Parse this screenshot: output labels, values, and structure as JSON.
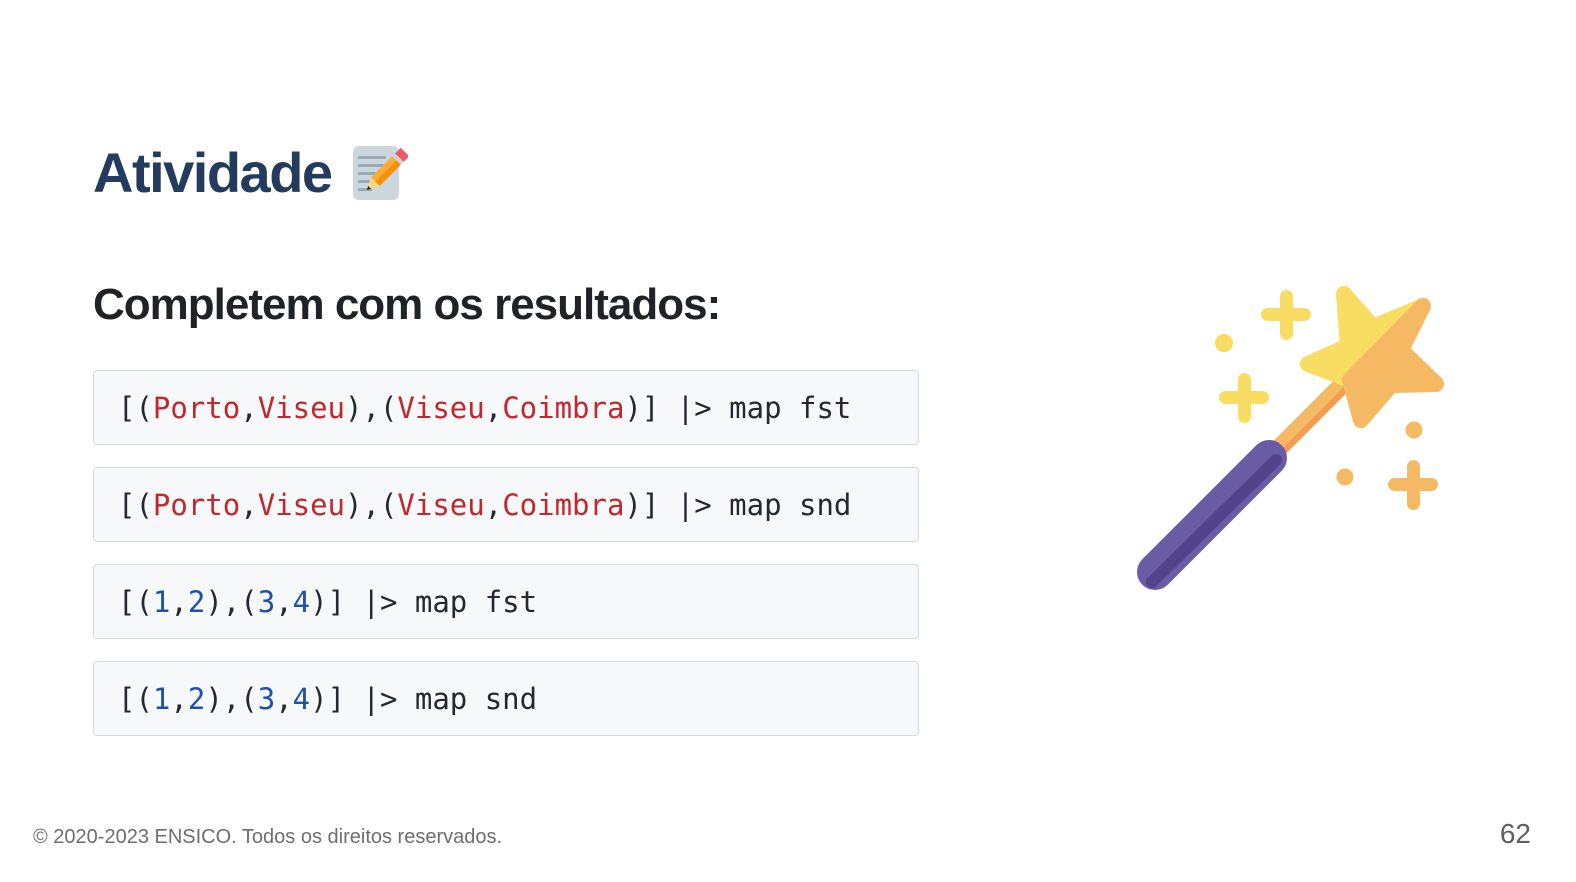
{
  "slide": {
    "title": "Atividade",
    "title_icon": "memo-pencil-icon",
    "subtitle": "Completem com os resultados:",
    "illustration": "magic-wand-icon"
  },
  "code_blocks": [
    {
      "tokens": [
        {
          "t": "[(",
          "k": "p"
        },
        {
          "t": "Porto",
          "k": "s"
        },
        {
          "t": ",",
          "k": "p"
        },
        {
          "t": "Viseu",
          "k": "s"
        },
        {
          "t": "),(",
          "k": "p"
        },
        {
          "t": "Viseu",
          "k": "s"
        },
        {
          "t": ",",
          "k": "p"
        },
        {
          "t": "Coimbra",
          "k": "s"
        },
        {
          "t": ")] |> map fst",
          "k": "p"
        }
      ]
    },
    {
      "tokens": [
        {
          "t": "[(",
          "k": "p"
        },
        {
          "t": "Porto",
          "k": "s"
        },
        {
          "t": ",",
          "k": "p"
        },
        {
          "t": "Viseu",
          "k": "s"
        },
        {
          "t": "),(",
          "k": "p"
        },
        {
          "t": "Viseu",
          "k": "s"
        },
        {
          "t": ",",
          "k": "p"
        },
        {
          "t": "Coimbra",
          "k": "s"
        },
        {
          "t": ")] |> map snd",
          "k": "p"
        }
      ]
    },
    {
      "tokens": [
        {
          "t": "[(",
          "k": "p"
        },
        {
          "t": "1",
          "k": "n"
        },
        {
          "t": ",",
          "k": "p"
        },
        {
          "t": "2",
          "k": "n"
        },
        {
          "t": "),(",
          "k": "p"
        },
        {
          "t": "3",
          "k": "n"
        },
        {
          "t": ",",
          "k": "p"
        },
        {
          "t": "4",
          "k": "n"
        },
        {
          "t": ")] |> map fst",
          "k": "p"
        }
      ]
    },
    {
      "tokens": [
        {
          "t": "[(",
          "k": "p"
        },
        {
          "t": "1",
          "k": "n"
        },
        {
          "t": ",",
          "k": "p"
        },
        {
          "t": "2",
          "k": "n"
        },
        {
          "t": "),(",
          "k": "p"
        },
        {
          "t": "3",
          "k": "n"
        },
        {
          "t": ",",
          "k": "p"
        },
        {
          "t": "4",
          "k": "n"
        },
        {
          "t": ")] |> map snd",
          "k": "p"
        }
      ]
    }
  ],
  "footer": {
    "copyright": "© 2020-2023 ENSICO. Todos os direitos reservados.",
    "page_number": "62"
  },
  "colors": {
    "title": "#233c5e",
    "string_token": "#c0282d",
    "number_token": "#1f4fa8",
    "code_background": "#f6f8fa"
  }
}
